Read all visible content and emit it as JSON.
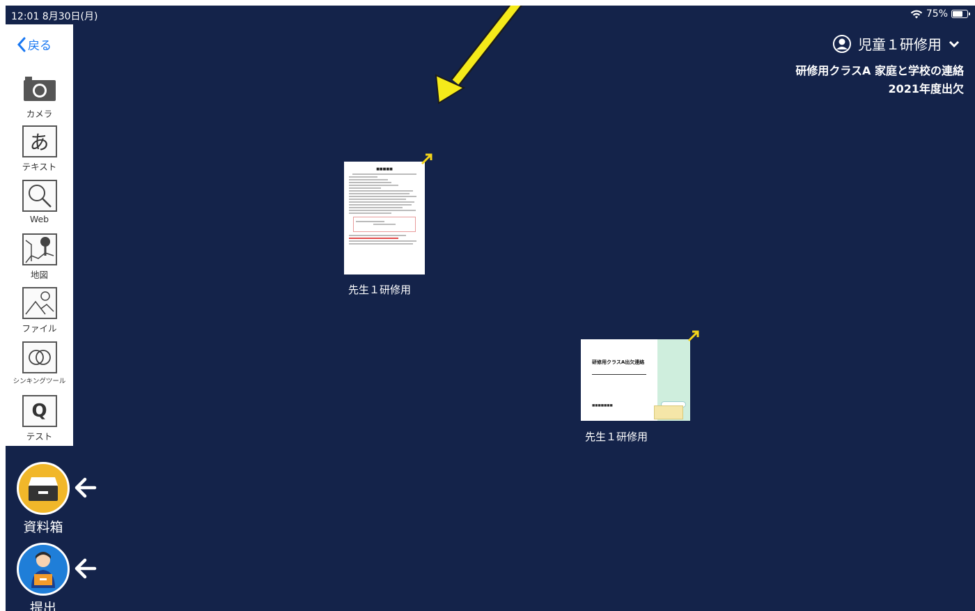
{
  "status_bar": {
    "time_date": "12:01  8月30日(月)",
    "wifi_icon": "wifi-icon",
    "battery": "75%",
    "battery_level": 0.75
  },
  "toolbar": {
    "back_label": "戻る",
    "tools": [
      {
        "name": "camera",
        "label": "カメラ",
        "icon": "camera-icon"
      },
      {
        "name": "text",
        "label": "テキスト",
        "icon": "text-a-icon",
        "glyph": "あ"
      },
      {
        "name": "web",
        "label": "Web",
        "icon": "magnifier-icon"
      },
      {
        "name": "map",
        "label": "地図",
        "icon": "map-pin-icon"
      },
      {
        "name": "file",
        "label": "ファイル",
        "icon": "image-file-icon"
      },
      {
        "name": "thinking",
        "label": "シンキングツール",
        "icon": "venn-icon"
      },
      {
        "name": "test",
        "label": "テスト",
        "icon": "quiz-icon",
        "glyph": "Q"
      }
    ]
  },
  "bottom_buttons": [
    {
      "name": "materials-box",
      "label": "資料箱",
      "icon": "inbox-tray-icon",
      "color": "#f1b72a"
    },
    {
      "name": "submit",
      "label": "提出",
      "icon": "student-submit-icon",
      "color": "#1f7ed8"
    }
  ],
  "header": {
    "user_name": "児童１研修用",
    "class_name": "研修用クラスA 家庭と学校の連絡",
    "document_title": "2021年度出欠"
  },
  "cards": [
    {
      "kind": "document",
      "owner": "先生１研修用"
    },
    {
      "kind": "slide",
      "owner": "先生１研修用",
      "slide_title": "研修用クラスA出欠連絡"
    }
  ],
  "colors": {
    "background": "#14234a",
    "accent": "#1877f2",
    "annotation": "#f5ea1a"
  }
}
